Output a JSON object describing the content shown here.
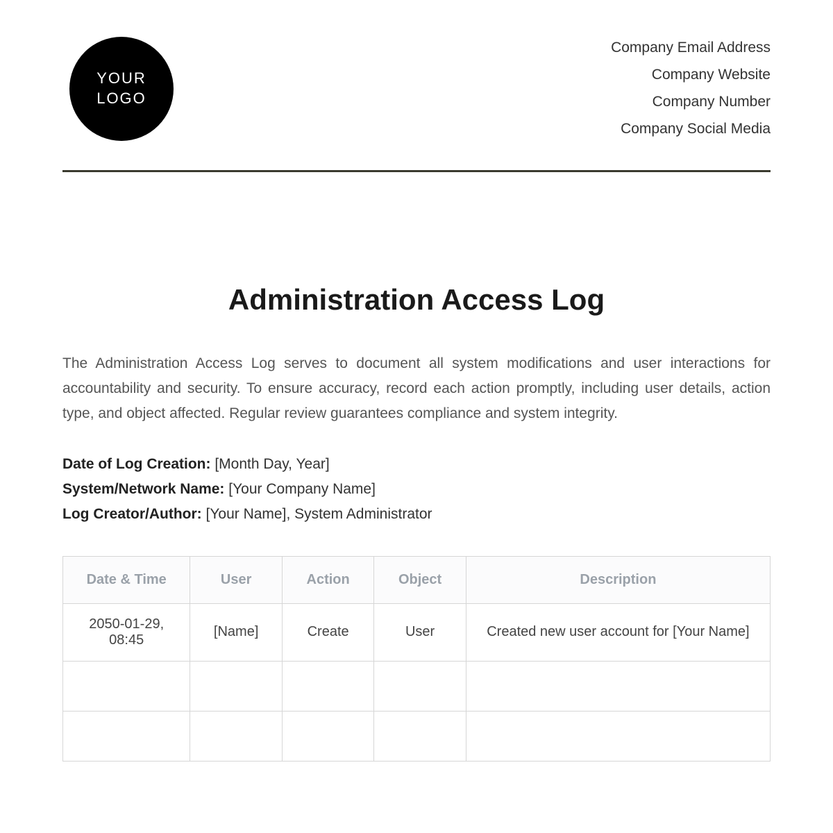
{
  "logo": {
    "line1": "YOUR",
    "line2": "LOGO"
  },
  "company": {
    "email": "Company Email Address",
    "website": "Company Website",
    "number": "Company Number",
    "social": "Company Social Media"
  },
  "title": "Administration Access Log",
  "intro": "The Administration Access Log serves to document all system modifications and user interactions for accountability and security. To ensure accuracy, record each action promptly, including user details, action type, and object affected. Regular review guarantees compliance and system integrity.",
  "meta": {
    "date_label": "Date of Log Creation:",
    "date_value": " [Month Day, Year]",
    "system_label": "System/Network Name:",
    "system_value": " [Your Company Name]",
    "author_label": "Log Creator/Author:",
    "author_value": " [Your Name], System Administrator"
  },
  "table": {
    "headers": {
      "datetime": "Date & Time",
      "user": "User",
      "action": "Action",
      "object": "Object",
      "description": "Description"
    },
    "rows": [
      {
        "datetime": "2050-01-29, 08:45",
        "user": "[Name]",
        "action": "Create",
        "object": "User",
        "description": "Created new user account for [Your Name]"
      },
      {
        "datetime": "",
        "user": "",
        "action": "",
        "object": "",
        "description": ""
      },
      {
        "datetime": "",
        "user": "",
        "action": "",
        "object": "",
        "description": ""
      }
    ]
  }
}
